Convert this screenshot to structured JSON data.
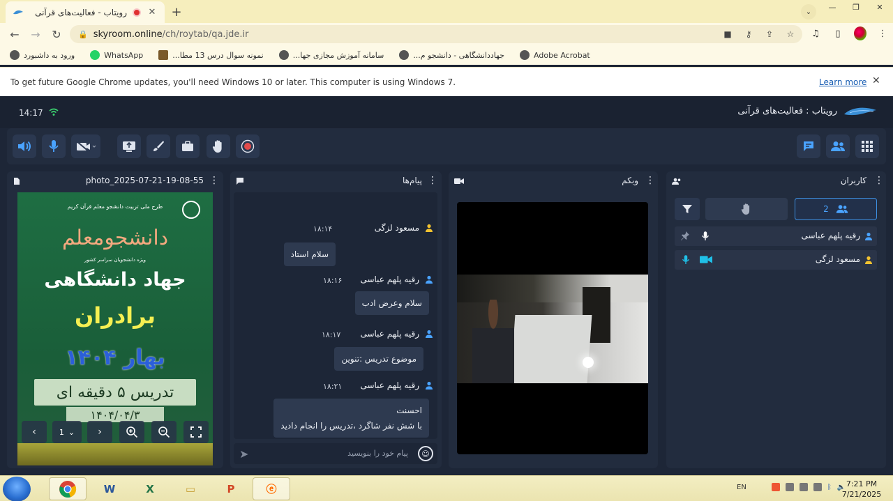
{
  "browser": {
    "tab_title": "رویتاب - فعالیت‌های قرآنی",
    "tab_close": "✕",
    "new_tab": "+",
    "url_host": "skyroom.online",
    "url_path": "/ch/roytab/qa.jde.ir",
    "bookmarks": [
      {
        "label": "Adobe Acrobat",
        "icon": "globe-icon"
      },
      {
        "label": "جهاددانشگاهی - دانشجو م...",
        "icon": "globe-icon"
      },
      {
        "label": "سامانه آموزش مجازی جها...",
        "icon": "globe-icon"
      },
      {
        "label": "نمونه سوال درس 13 مطا...",
        "icon": "book-icon"
      },
      {
        "label": "WhatsApp",
        "icon": "whatsapp-icon"
      },
      {
        "label": "ورود به داشبورد",
        "icon": "globe-icon"
      }
    ],
    "infobar_text": "To get future Google Chrome updates, you'll need Windows 10 or later. This computer is using Windows 7.",
    "infobar_link": "Learn more"
  },
  "app": {
    "time": "14:17",
    "room_title": "رویتاب : فعالیت‌های قرآنی",
    "photo_panel_title": "photo_2025-07-21-19-08-55",
    "chat_panel_title": "پیام‌ها",
    "webcam_panel_title": "وبکم",
    "users_panel_title": "کاربران",
    "photo": {
      "poster_line1": "طرح ملی تربیت دانشجو معلم قرآن کریم",
      "poster_line2": "دانشجومعلم",
      "poster_line3": "ویژه دانشجویان سراسر کشور",
      "poster_line4": "جهاد دانشگاهی",
      "poster_line5": "برادران",
      "poster_line6": "بهار ۱۴۰۴",
      "poster_band": "تدریس ۵ دقیقه ای",
      "poster_date": "۱۴۰۴/۰۴/۳",
      "page_number": "1"
    },
    "messages": [
      {
        "sender": "مسعود لزگی",
        "time": "۱۸:۱۴",
        "lines": [
          "سلام استاد"
        ],
        "role": "admin"
      },
      {
        "sender": "رقیه پلهم عباسی",
        "time": "۱۸:۱۶",
        "lines": [
          "سلام وعرض ادب"
        ],
        "role": "user"
      },
      {
        "sender": "رقیه پلهم عباسی",
        "time": "۱۸:۱۷",
        "lines": [
          "موضوع تدریس :تنوین"
        ],
        "role": "user"
      },
      {
        "sender": "رقیه پلهم عباسی",
        "time": "۱۸:۲۱",
        "lines": [
          "احسنت",
          "با شش نفر شاگرد ،تدریس را انجام دادید"
        ],
        "role": "user"
      }
    ],
    "chat_placeholder": "پیام خود را بنویسید",
    "user_count": "2",
    "users": [
      {
        "name": "رقیه پلهم عباسی",
        "role": "user"
      },
      {
        "name": "مسعود لزگی",
        "role": "admin"
      }
    ],
    "colors": {
      "accent": "#4aa3ff",
      "admin": "#f2c230",
      "user": "#4aa3ff",
      "record": "#e24b4b"
    }
  },
  "taskbar": {
    "lang": "EN",
    "time": "7:21 PM",
    "date": "7/21/2025"
  }
}
